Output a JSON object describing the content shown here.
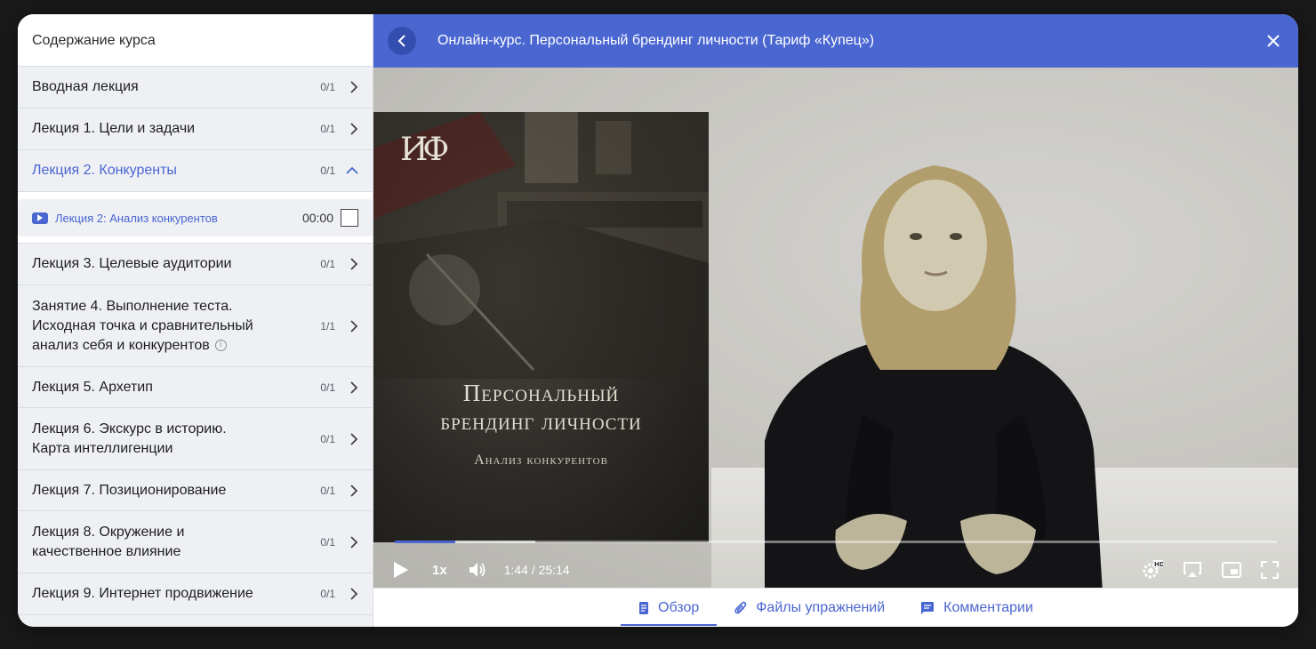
{
  "sidebar": {
    "header": "Содержание курса",
    "lessons": [
      {
        "title": "Вводная лекция",
        "count": "0/1"
      },
      {
        "title": "Лекция 1. Цели и задачи",
        "count": "0/1"
      },
      {
        "title": "Лекция 2. Конкуренты",
        "count": "0/1",
        "expanded": true
      },
      {
        "title": "Лекция 3. Целевые аудитории",
        "count": "0/1"
      },
      {
        "title": "Занятие 4. Выполнение теста. Исходная точка и сравнительный анализ себя и конкурентов",
        "count": "1/1",
        "info_icon": "info-icon"
      },
      {
        "title": "Лекция 5. Архетип",
        "count": "0/1"
      },
      {
        "title": "Лекция 6. Экскурс в историю. Карта интеллигенции",
        "count": "0/1"
      },
      {
        "title": "Лекция 7. Позиционирование",
        "count": "0/1"
      },
      {
        "title": "Лекция 8. Окружение и качественное влияние",
        "count": "0/1"
      },
      {
        "title": "Лекция 9. Интернет продвижение",
        "count": "0/1"
      }
    ],
    "sublesson": {
      "title": "Лекция 2: Анализ конкурентов",
      "time": "00:00",
      "icon": "video-play-icon"
    }
  },
  "topbar": {
    "title": "Онлайн-курс. Персональный брендинг личности (Тариф «Купец»)",
    "back_icon": "chevron-left-icon",
    "close_icon": "close-icon"
  },
  "video": {
    "poster_logo": "ИФ",
    "poster_title_line1": "Персональный",
    "poster_title_line2": "брендинг личности",
    "poster_subtitle": "Анализ конкурентов",
    "speed": "1x",
    "timecode": "1:44 / 25:14",
    "progress": 0.069,
    "buffered": 0.159
  },
  "tabs": [
    {
      "label": "Обзор",
      "icon": "document-icon",
      "active": true
    },
    {
      "label": "Файлы упражнений",
      "icon": "paperclip-icon"
    },
    {
      "label": "Комментарии",
      "icon": "comment-icon"
    }
  ],
  "colors": {
    "accent": "#4a66d1",
    "sidebar_bg": "#eef0f4"
  }
}
